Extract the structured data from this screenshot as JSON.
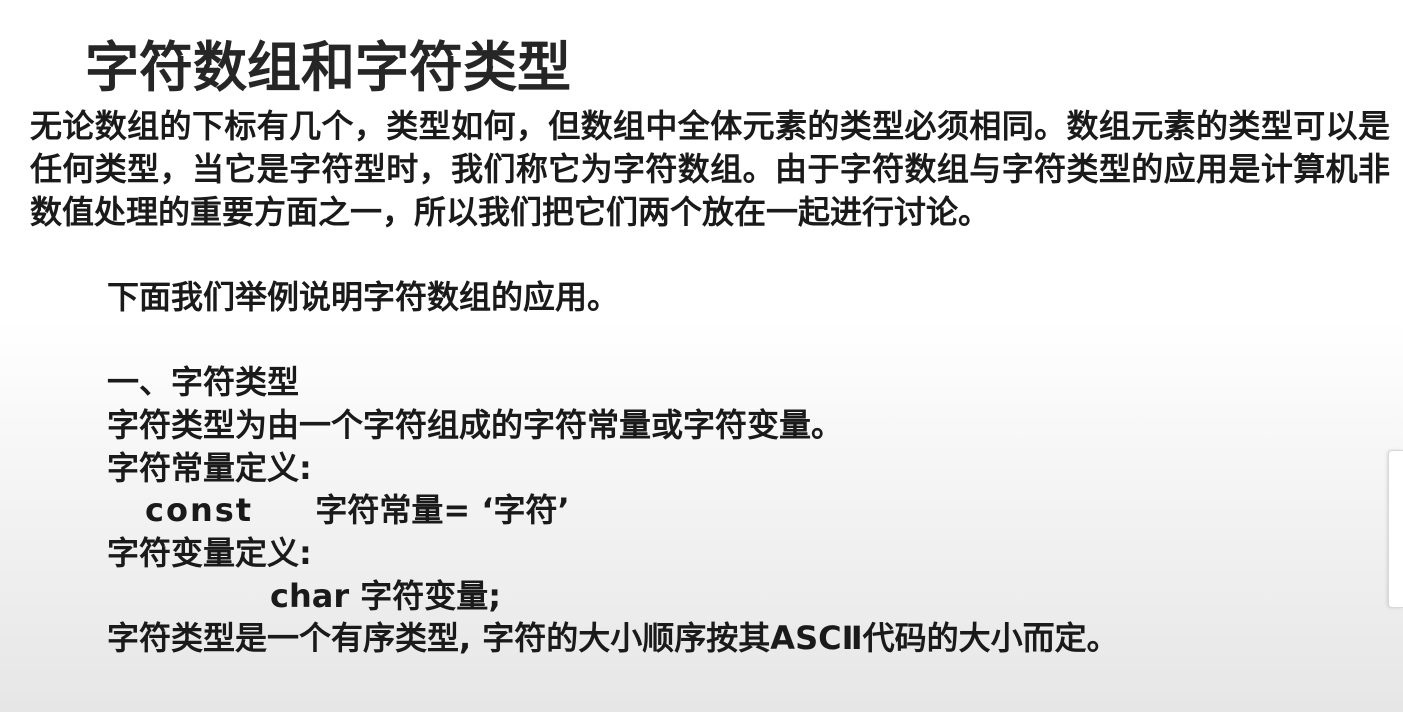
{
  "slide": {
    "title": "字符数组和字符类型",
    "intro_paragraph": "无论数组的下标有几个，类型如何，但数组中全体元素的类型必须相同。数组元素的类型可以是任何类型，当它是字符型时，我们称它为字符数组。由于字符数组与字符类型的应用是计算机非数值处理的重要方面之一，所以我们把它们两个放在一起进行讨论。",
    "example_line": "下面我们举例说明字符数组的应用。",
    "section_heading": "一、字符类型",
    "char_type_desc": "字符类型为由一个字符组成的字符常量或字符变量。",
    "const_def_label": "字符常量定义:",
    "const_keyword": "const",
    "const_rest": "字符常量= ‘字符’",
    "var_def_label": "字符变量定义:",
    "var_code": "char 字符变量;",
    "ordinal_note": "字符类型是一个有序类型, 字符的大小顺序按其ASCⅡ代码的大小而定。"
  }
}
